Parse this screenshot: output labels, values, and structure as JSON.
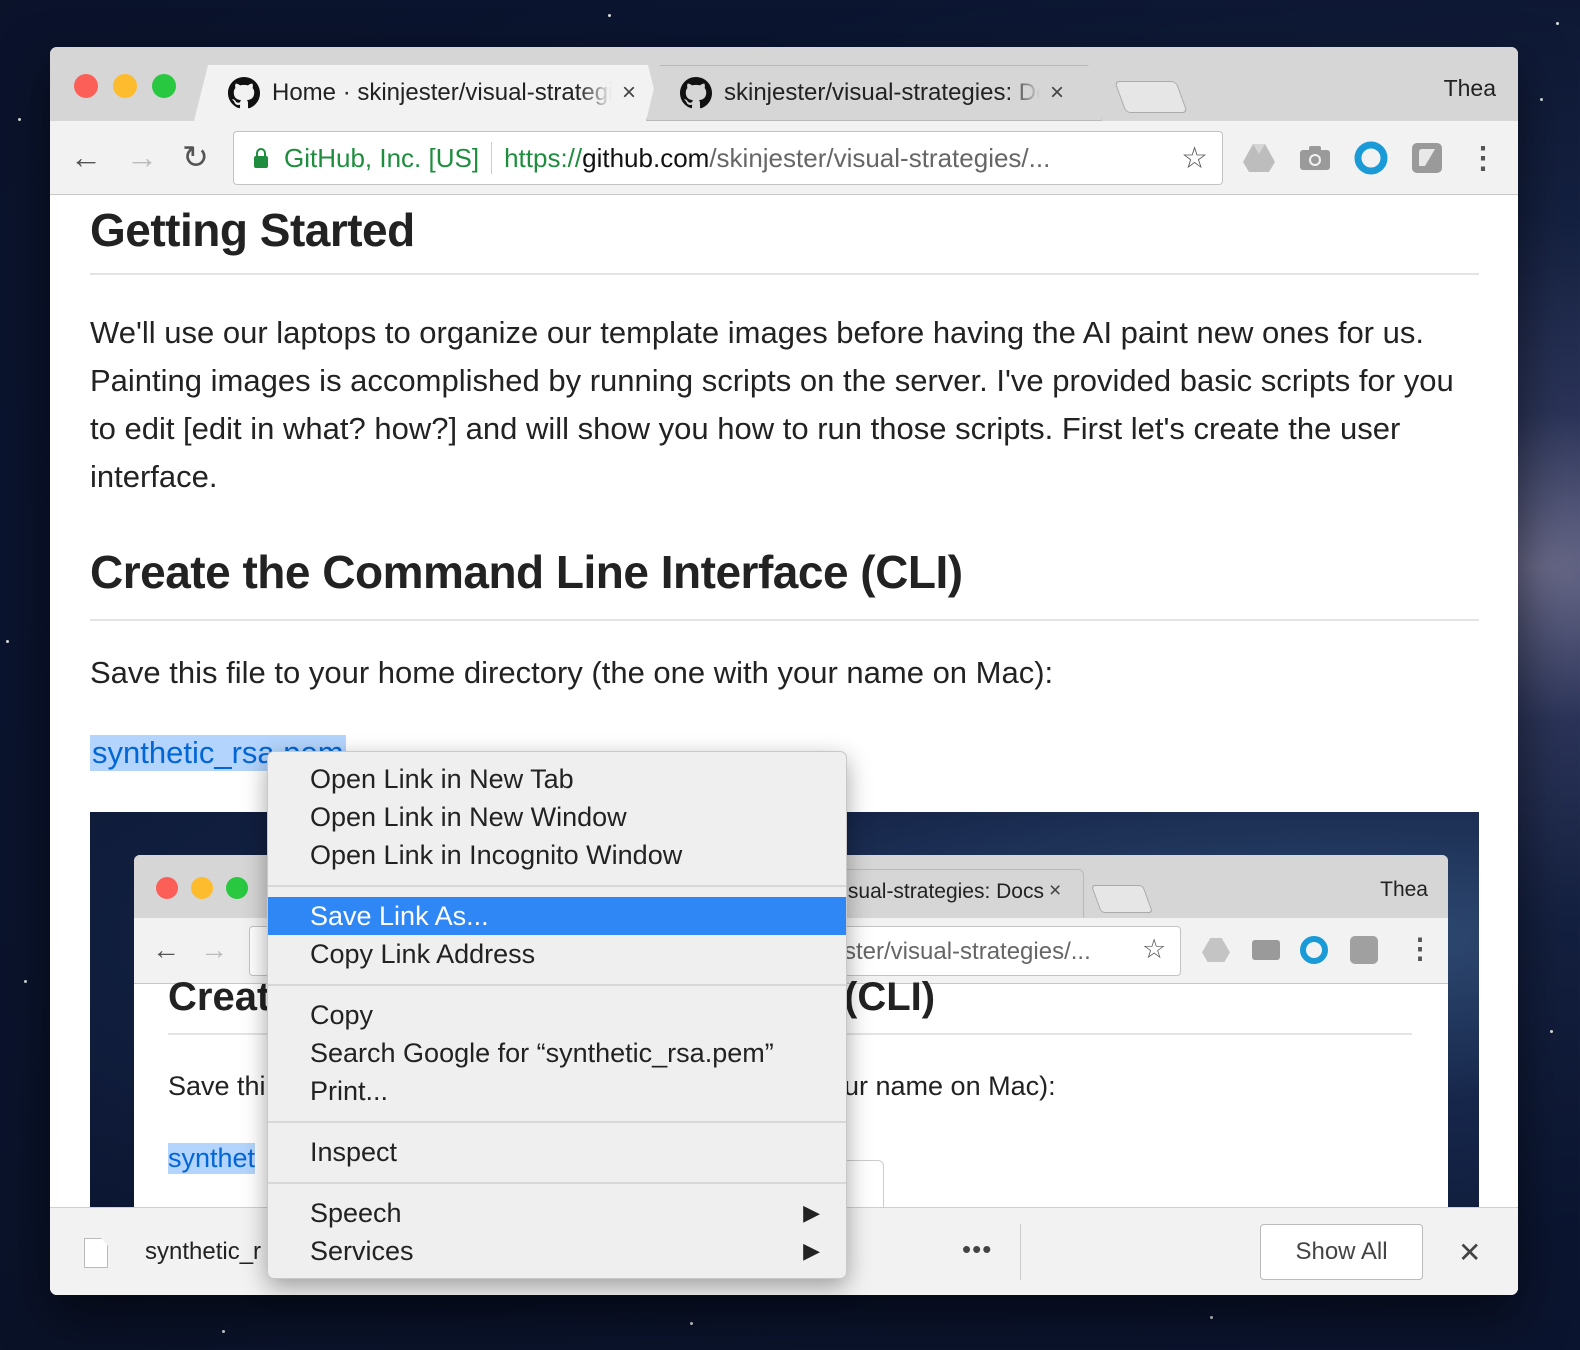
{
  "browser": {
    "tabs": [
      {
        "title": "Home · skinjester/visual-strategies",
        "close": "×"
      },
      {
        "title": "skinjester/visual-strategies: Docs",
        "close": "×"
      }
    ],
    "profile_name": "Thea",
    "nav": {
      "back": "←",
      "forward": "→",
      "reload": "↻"
    },
    "omnibox": {
      "ev_label": "GitHub, Inc. [US]",
      "url_scheme": "https://",
      "url_host": "github.com",
      "url_path": "/skinjester/visual-strategies/..."
    },
    "bookmark_star": "☆",
    "extensions": [
      "drive-icon",
      "camera-icon",
      "ring-icon",
      "extension-icon"
    ],
    "menu_glyph": "⋮"
  },
  "page": {
    "heading1": "Getting Started",
    "paragraph": "We'll use our laptops to organize our template images before having the AI paint new ones for us. Painting images is accomplished by running scripts on the server. I've provided basic scripts for you to edit [edit in what? how?] and will show you how to run those scripts. First let's create the user interface.",
    "heading2": "Create the Command Line Interface (CLI)",
    "save_text": "Save this file to your home directory (the one with your name on Mac):",
    "link_text": "synthetic_rsa.pem"
  },
  "embedded_screenshot": {
    "tab_title": "skinjester/visual-strategies: Docs",
    "tab_close": "×",
    "profile_name": "Thea",
    "url_fragment": "ster/visual-strategies/...",
    "heading_left": "Creat",
    "heading_right": "(CLI)",
    "text_left": "Save thi",
    "text_right": "ur name on Mac):",
    "link_fragment": "synthet"
  },
  "context_menu": {
    "groups": [
      [
        "Open Link in New Tab",
        "Open Link in New Window",
        "Open Link in Incognito Window"
      ],
      [
        "Save Link As...",
        "Copy Link Address"
      ],
      [
        "Copy",
        "Search Google for “synthetic_rsa.pem”",
        "Print..."
      ],
      [
        "Inspect"
      ],
      [
        "Speech",
        "Services"
      ]
    ],
    "selected": "Save Link As...",
    "submenu_arrow": "▶"
  },
  "download_bar": {
    "file_name": "synthetic_r",
    "more": "•••",
    "show_all": "Show All",
    "close": "✕"
  },
  "colors": {
    "accent": "#2f87f5",
    "link": "#0366d6",
    "secure_green": "#1e8e3e",
    "traffic_red": "#fc5f57",
    "traffic_yellow": "#fdbc2e",
    "traffic_green": "#28c840"
  }
}
